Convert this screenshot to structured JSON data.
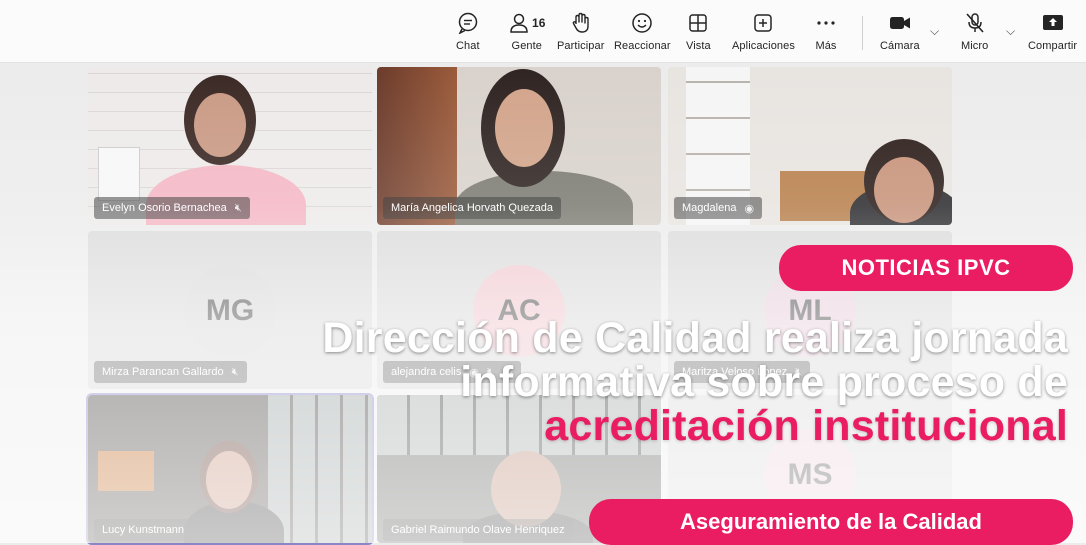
{
  "toolbar": {
    "chat": {
      "label": "Chat",
      "icon": "chat-icon"
    },
    "people": {
      "label": "Gente",
      "count": "16",
      "icon": "people-icon"
    },
    "raise": {
      "label": "Participar",
      "icon": "raise-hand-icon"
    },
    "react": {
      "label": "Reaccionar",
      "icon": "smiley-icon"
    },
    "view": {
      "label": "Vista",
      "icon": "grid-icon"
    },
    "apps": {
      "label": "Aplicaciones",
      "icon": "plus-box-icon"
    },
    "more": {
      "label": "Más",
      "icon": "more-icon"
    },
    "camera": {
      "label": "Cámara",
      "icon": "camera-icon"
    },
    "mic": {
      "label": "Micro",
      "icon": "mic-off-icon"
    },
    "share": {
      "label": "Compartir",
      "icon": "share-icon"
    }
  },
  "participants": [
    {
      "name": "Evelyn Osorio Bernachea",
      "status": "muted"
    },
    {
      "name": "María Angelica Horvath Quezada",
      "status": ""
    },
    {
      "name": "Magdalena",
      "status": "presenting"
    },
    {
      "name": "Mirza Parancan Gallardo",
      "initials": "MG",
      "status": "muted"
    },
    {
      "name": "alejandra celis",
      "initials": "AC",
      "status": "muted"
    },
    {
      "name": "Maritza Veloso Lopez",
      "initials": "ML",
      "status": "muted"
    },
    {
      "name": "Lucy Kunstmann",
      "status": ""
    },
    {
      "name": "Gabriel Raimundo Olave Henriquez",
      "status": ""
    },
    {
      "name": "",
      "initials": "MS",
      "status": ""
    }
  ],
  "news": {
    "tag": "NOTICIAS IPVC",
    "headline_line1": "Dirección de Calidad realiza jornada",
    "headline_line2": "informativa sobre proceso de",
    "headline_accent": "acreditación institucional",
    "subtitle": "Aseguramiento de la Calidad"
  },
  "colors": {
    "accent": "#ea1d63",
    "toolbar_bg": "#fbfbfb"
  }
}
